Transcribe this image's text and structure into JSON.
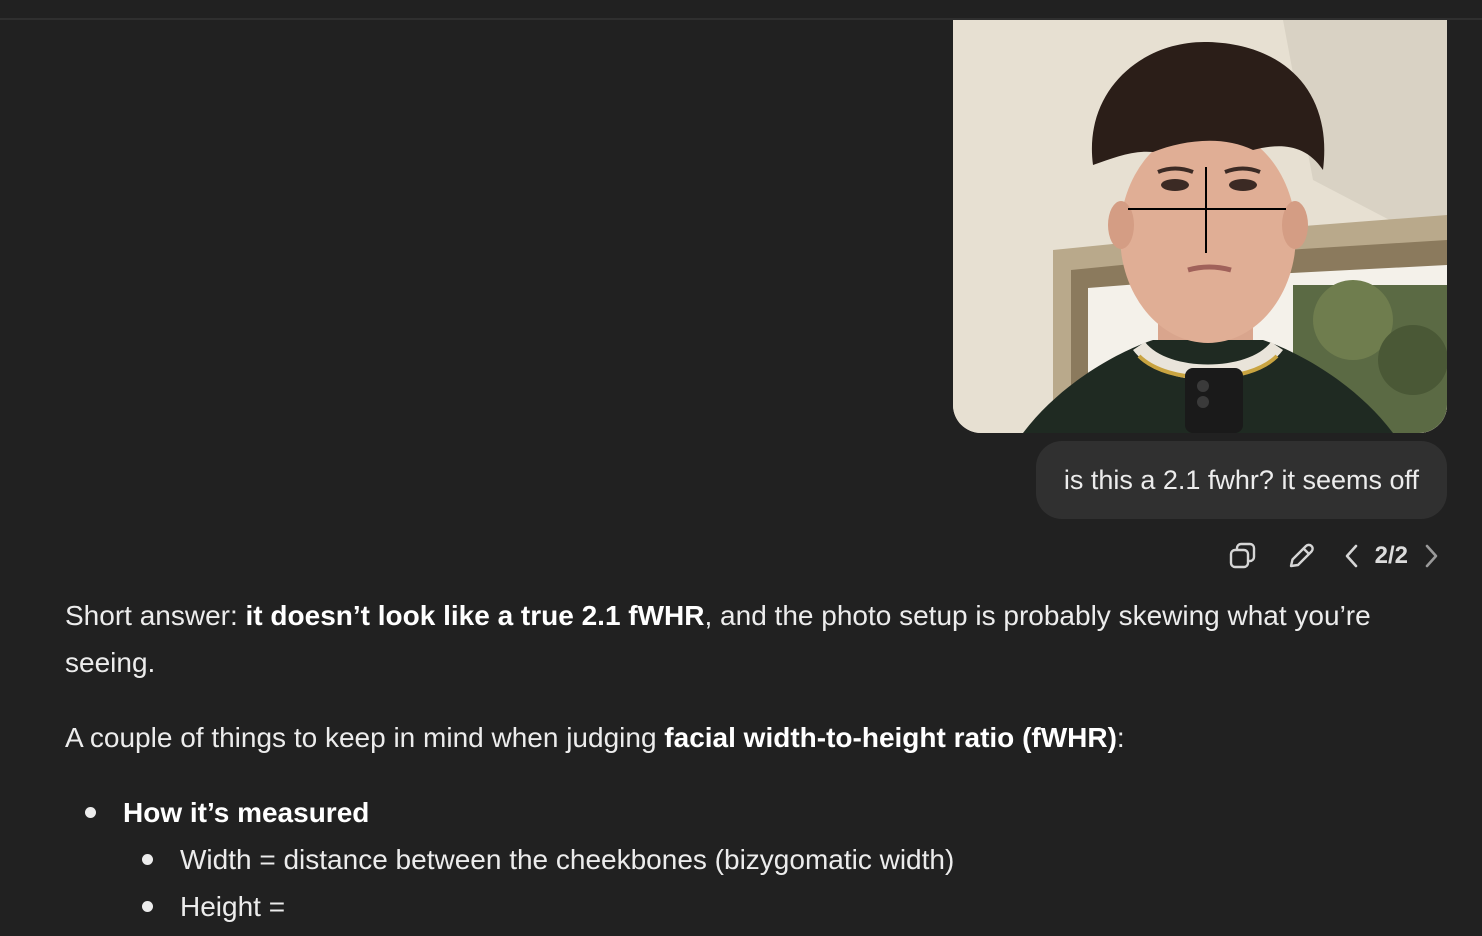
{
  "user_message": {
    "image_label": "user-uploaded selfie photo",
    "text": "is this a 2.1 fwhr? it seems off"
  },
  "actions": {
    "copy_icon": "copy-icon",
    "edit_icon": "pencil-icon",
    "prev_icon": "chevron-left-icon",
    "next_icon": "chevron-right-icon",
    "pager": "2/2"
  },
  "response": {
    "p1_prefix": "Short answer: ",
    "p1_bold": "it doesn’t look like a true 2.1 fWHR",
    "p1_suffix": ", and the photo setup is probably skewing what you’re seeing.",
    "p2_prefix": "A couple of things to keep in mind when judging ",
    "p2_bold": "facial width-to-height ratio (fWHR)",
    "p2_suffix": ":",
    "list": {
      "item1_title": "How it’s measured",
      "sub1": "Width = distance between the cheekbones (bizygomatic width)",
      "sub2": "Height ="
    }
  },
  "colors": {
    "background": "#212121",
    "bubble": "#303030",
    "text": "#ececec"
  }
}
